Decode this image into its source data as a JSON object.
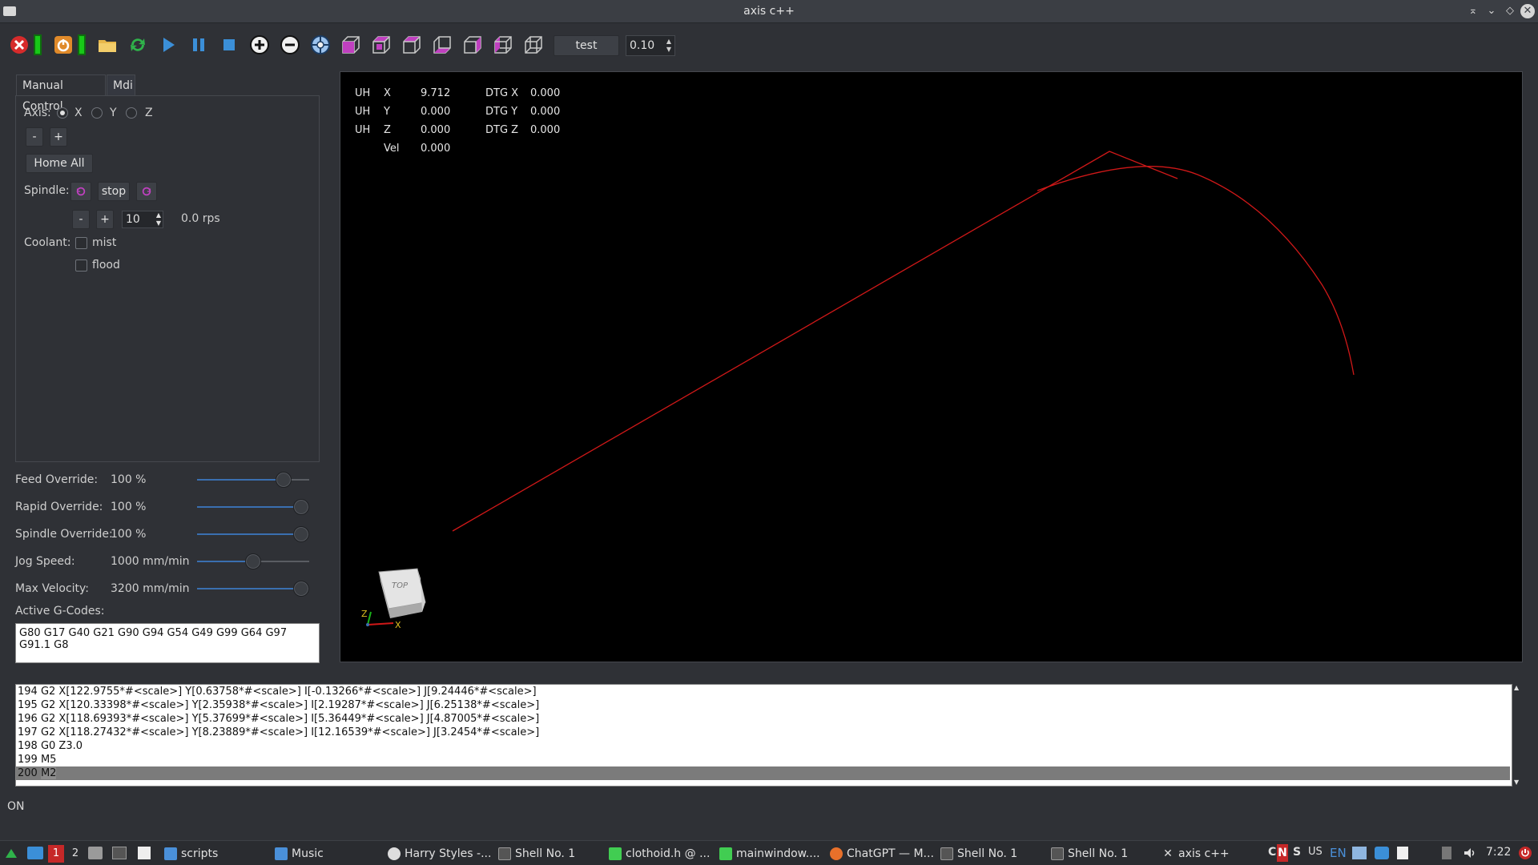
{
  "window": {
    "title": "axis c++"
  },
  "toolbar": {
    "program_name": "test",
    "scale_value": "0.10"
  },
  "tabs": [
    {
      "label": "Manual Control",
      "active": true
    },
    {
      "label": "Mdi",
      "active": false
    }
  ],
  "manual": {
    "axis_label": "Axis:",
    "axes": [
      {
        "label": "X",
        "selected": true
      },
      {
        "label": "Y",
        "selected": false
      },
      {
        "label": "Z",
        "selected": false
      }
    ],
    "jog_minus": "-",
    "jog_plus": "+",
    "home_all": "Home All",
    "spindle_label": "Spindle:",
    "spindle_stop": "stop",
    "spindle_minus": "-",
    "spindle_plus": "+",
    "spindle_speed_value": "10",
    "spindle_rate": "0.0 rps",
    "coolant_label": "Coolant:",
    "mist_label": "mist",
    "flood_label": "flood"
  },
  "overrides": [
    {
      "label": "Feed Override:",
      "value": "100 %",
      "fraction": 0.82
    },
    {
      "label": "Rapid Override:",
      "value": "100 %",
      "fraction": 1.0
    },
    {
      "label": "Spindle Override:",
      "value": "100 %",
      "fraction": 1.0
    },
    {
      "label": "Jog Speed:",
      "value": "1000 mm/min",
      "fraction": 0.5
    },
    {
      "label": "Max Velocity:",
      "value": "3200 mm/min",
      "fraction": 1.0
    }
  ],
  "active_gcodes": {
    "label": "Active G-Codes:",
    "line1": "G80 G17 G40 G21 G90 G94 G54 G49 G99 G64 G97",
    "line2": "G91.1 G8"
  },
  "dro": {
    "rows": [
      {
        "flag": "UH",
        "axis": "X",
        "pos": "9.712",
        "dtg_label": "DTG X",
        "dtg": "0.000"
      },
      {
        "flag": "UH",
        "axis": "Y",
        "pos": "0.000",
        "dtg_label": "DTG Y",
        "dtg": "0.000"
      },
      {
        "flag": "UH",
        "axis": "Z",
        "pos": "0.000",
        "dtg_label": "DTG Z",
        "dtg": "0.000"
      }
    ],
    "vel_label": "Vel",
    "vel": "0.000"
  },
  "view_cube": {
    "face_label": "TOP",
    "axis_z": "Z",
    "axis_x": "X"
  },
  "program_listing": [
    {
      "text": "194 G2 X[122.9755*#<scale>] Y[0.63758*#<scale>] I[-0.13266*#<scale>] J[9.24446*#<scale>]"
    },
    {
      "text": "195 G2 X[120.33398*#<scale>] Y[2.35938*#<scale>] I[2.19287*#<scale>] J[6.25138*#<scale>]"
    },
    {
      "text": "196 G2 X[118.69393*#<scale>] Y[5.37699*#<scale>] I[5.36449*#<scale>] J[4.87005*#<scale>]"
    },
    {
      "text": "197 G2 X[118.27432*#<scale>] Y[8.23889*#<scale>] I[12.16539*#<scale>] J[3.2454*#<scale>]"
    },
    {
      "text": "198 G0 Z3.0"
    },
    {
      "text": "199 M5"
    }
  ],
  "program_selected": {
    "number": "200",
    "command": "M2"
  },
  "status": {
    "text": "ON"
  },
  "taskbar": {
    "workspace_1": "1",
    "workspace_2": "2",
    "items": [
      {
        "label": "scripts"
      },
      {
        "label": "Music"
      },
      {
        "label": "Harry Styles -..."
      },
      {
        "label": "Shell No. 1"
      },
      {
        "label": "clothoid.h @ ..."
      },
      {
        "label": "mainwindow...."
      },
      {
        "label": "ChatGPT — M..."
      },
      {
        "label": "Shell No. 1"
      },
      {
        "label": "Shell No. 1"
      },
      {
        "label": "axis c++"
      }
    ],
    "tray_c": "C",
    "tray_n": "N",
    "tray_s": "S",
    "tray_us": "US",
    "tray_en": "EN",
    "clock": "7:22"
  },
  "colors": {
    "toolpath": "#d01818",
    "accent": "#3a6fb0",
    "magenta": "#c040c0"
  }
}
